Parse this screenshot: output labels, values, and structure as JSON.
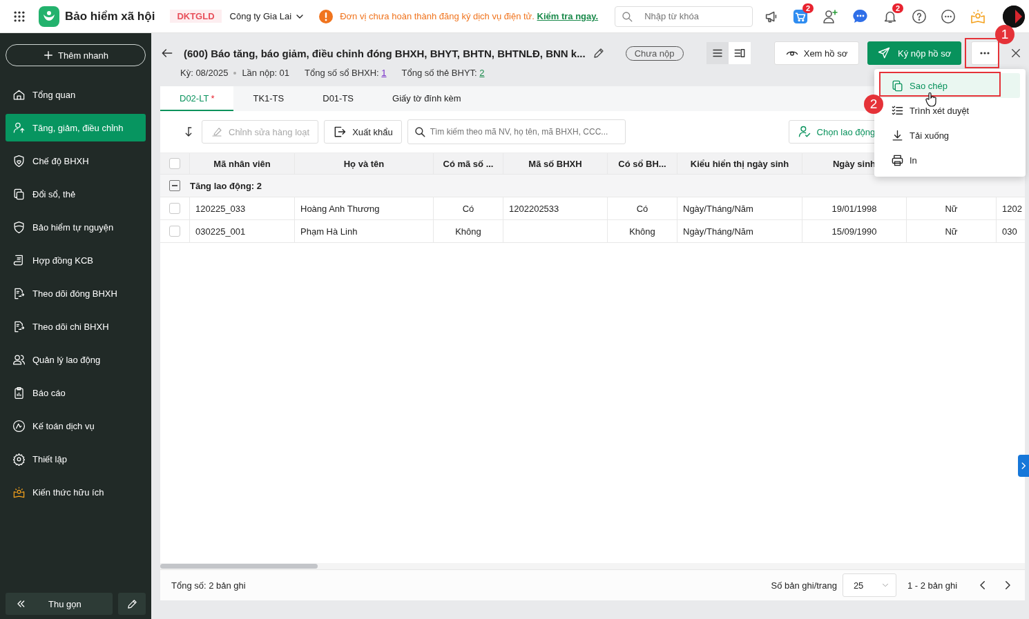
{
  "topbar": {
    "app_name": "Bảo hiểm xã hội",
    "tag": "DKTGLD",
    "company": "Công ty Gia Lai",
    "warning": {
      "text": "Đơn vị chưa hoàn thành đăng ký dịch vụ điện tử.",
      "link": "Kiểm tra ngay."
    },
    "search": {
      "placeholder": "Nhập từ khóa"
    },
    "cart_badge": "2",
    "bell_badge": "2"
  },
  "sidebar": {
    "quick_add": "Thêm nhanh",
    "items": [
      {
        "label": "Tổng quan",
        "selected": false
      },
      {
        "label": "Tăng, giảm, điều chỉnh",
        "selected": true
      },
      {
        "label": "Chế độ BHXH",
        "selected": false
      },
      {
        "label": "Đổi sổ, thẻ",
        "selected": false
      },
      {
        "label": "Bảo hiểm tự nguyện",
        "selected": false
      },
      {
        "label": "Hợp đồng KCB",
        "selected": false
      },
      {
        "label": "Theo dõi đóng BHXH",
        "selected": false
      },
      {
        "label": "Theo dõi chi BHXH",
        "selected": false
      },
      {
        "label": "Quản lý lao động",
        "selected": false
      },
      {
        "label": "Báo cáo",
        "selected": false
      },
      {
        "label": "Kế toán dịch vụ",
        "selected": false
      },
      {
        "label": "Thiết lập",
        "selected": false
      },
      {
        "label": "Kiến thức hữu ích",
        "selected": false
      }
    ],
    "collapse": "Thu gọn"
  },
  "document": {
    "title": "(600) Báo tăng, báo giảm, điều chỉnh đóng BHXH, BHYT, BHTN, BHTNLĐ, BNN k...",
    "status": "Chưa nộp",
    "view_modes": [
      {
        "selected": true
      },
      {
        "selected": false
      }
    ],
    "buttons": [
      {
        "label": "Xem hồ sơ",
        "kind": "outline"
      },
      {
        "label": "Ký nộp hồ sơ",
        "kind": "primary"
      }
    ],
    "meta": [
      {
        "label": "Kỳ: 08/2025"
      },
      {
        "label": "Lần nộp: 01"
      },
      {
        "label": "Tổng số sổ BHXH:",
        "link": "1"
      },
      {
        "label": "Tổng số thẻ BHYT:",
        "link": "2"
      }
    ]
  },
  "tabs": [
    {
      "label": "D02-LT",
      "marker": "*",
      "selected": true
    },
    {
      "label": "TK1-TS",
      "selected": false
    },
    {
      "label": "D01-TS",
      "selected": false
    },
    {
      "label": "Giấy tờ đính kèm",
      "selected": false
    }
  ],
  "toolbar": {
    "bulk_edit": {
      "label": "Chỉnh sửa hàng loạt",
      "disabled": true
    },
    "export": "Xuất khẩu",
    "search": {
      "placeholder": "Tìm kiếm theo mã NV, họ tên, mã BHXH, CCC..."
    },
    "pick_employee": "Chọn lao động"
  },
  "table": {
    "all_checked": false,
    "columns": [
      "Mã nhân viên",
      "Họ và tên",
      "Có mã số ...",
      "Mã số BHXH",
      "Có sổ BH...",
      "Kiểu hiển thị ngày sinh",
      "Ngày sinh"
    ],
    "groups": [
      {
        "label": "Tăng lao động: 2",
        "expanded": true,
        "rows": [
          {
            "checked": false,
            "cells": [
              "120225_033",
              "Hoàng Anh Thương",
              "Có",
              "1202202533",
              "Có",
              "Ngày/Tháng/Năm",
              "19/01/1998",
              "Nữ",
              "1202"
            ]
          },
          {
            "checked": false,
            "cells": [
              "030225_001",
              "Phạm Hà Linh",
              "Không",
              null,
              "Không",
              "Ngày/Tháng/Năm",
              "15/09/1990",
              "Nữ",
              "030"
            ]
          }
        ]
      }
    ]
  },
  "footer": {
    "total": "Tổng số: 2 bản ghi",
    "page_size_label": "Số bản ghi/trang",
    "page_size": "25",
    "range": "1 - 2 bản ghi"
  },
  "menu": {
    "items": [
      {
        "label": "Sao chép",
        "selected": true
      },
      {
        "label": "Trình xét duyệt",
        "selected": false
      },
      {
        "label": "Tải xuống",
        "selected": false
      },
      {
        "label": "In",
        "selected": false
      }
    ]
  },
  "annotations": [
    {
      "label": "1"
    },
    {
      "label": "2"
    }
  ]
}
